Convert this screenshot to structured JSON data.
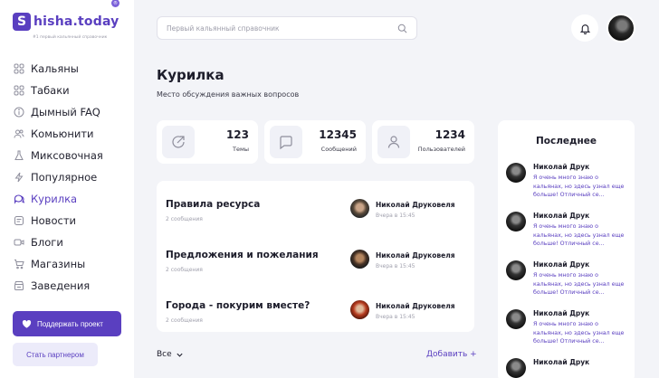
{
  "brand": {
    "name": "hisha.today",
    "mark": "S",
    "badge": "®",
    "tagline": "#1 первый кальянный справочник",
    "accent_color": "#5a3fc0"
  },
  "sidebar": {
    "items": [
      {
        "label": "Кальяны",
        "icon": "grid-icon",
        "active": false
      },
      {
        "label": "Табаки",
        "icon": "grid-icon",
        "active": false
      },
      {
        "label": "Дымный FAQ",
        "icon": "info-icon",
        "active": false
      },
      {
        "label": "Комьюнити",
        "icon": "users-icon",
        "active": false
      },
      {
        "label": "Миксовочная",
        "icon": "flask-icon",
        "active": false
      },
      {
        "label": "Популярное",
        "icon": "bolt-icon",
        "active": false
      },
      {
        "label": "Курилка",
        "icon": "chat-icon",
        "active": true
      },
      {
        "label": "Новости",
        "icon": "newspaper-icon",
        "active": false
      },
      {
        "label": "Блоги",
        "icon": "video-icon",
        "active": false
      },
      {
        "label": "Магазины",
        "icon": "cart-icon",
        "active": false
      },
      {
        "label": "Заведения",
        "icon": "store-icon",
        "active": false
      }
    ],
    "support_label": "Поддержать проект",
    "partner_label": "Стать партнером"
  },
  "header": {
    "search_placeholder": "Первый кальянный справочник"
  },
  "main": {
    "title": "Курилка",
    "subtitle": "Место обсуждения важных вопросов",
    "stats": [
      {
        "value": "123",
        "label": "Темы",
        "icon": "share-icon"
      },
      {
        "value": "12345",
        "label": "Сообщений",
        "icon": "message-icon"
      },
      {
        "value": "1234",
        "label": "Пользователей",
        "icon": "user-icon"
      }
    ],
    "threads": [
      {
        "title": "Правила ресурса",
        "count": "2 сообщения",
        "author": "Николай Друковеля",
        "time": "Вчера в 15:45"
      },
      {
        "title": "Предложения и пожелания",
        "count": "2 сообщения",
        "author": "Николай Друковеля",
        "time": "Вчера в 15:45"
      },
      {
        "title": "Города - покурим вместе?",
        "count": "2 сообщения",
        "author": "Николай Друковеля",
        "time": "Вчера в 15:45"
      }
    ],
    "filter_label": "Все",
    "add_label": "Добавить +"
  },
  "latest": {
    "title": "Последнее",
    "items": [
      {
        "author": "Николай Друк",
        "text": "Я очень много знаю о кальянах, но здесь узнал еще больше! Отличный се..."
      },
      {
        "author": "Николай Друк",
        "text": "Я очень много знаю о кальянах, но здесь узнал еще больше! Отличный се..."
      },
      {
        "author": "Николай Друк",
        "text": "Я очень много знаю о кальянах, но здесь узнал еще больше! Отличный се..."
      },
      {
        "author": "Николай Друк",
        "text": "Я очень много знаю о кальянах, но здесь узнал еще больше! Отличный се..."
      },
      {
        "author": "Николай Друк",
        "text": ""
      }
    ]
  }
}
